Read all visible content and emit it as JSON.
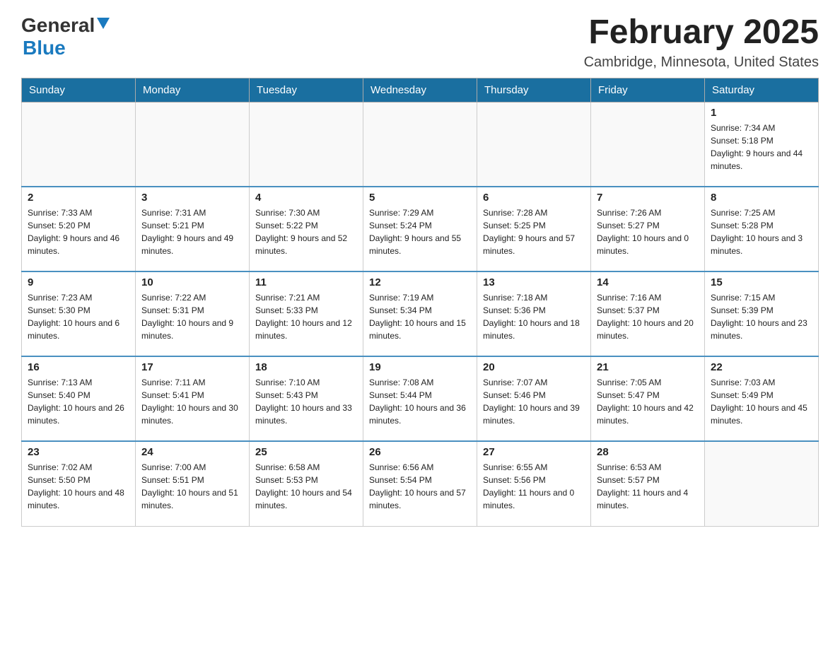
{
  "header": {
    "logo_general": "General",
    "logo_blue": "Blue",
    "month_title": "February 2025",
    "location": "Cambridge, Minnesota, United States"
  },
  "days_of_week": [
    "Sunday",
    "Monday",
    "Tuesday",
    "Wednesday",
    "Thursday",
    "Friday",
    "Saturday"
  ],
  "weeks": [
    [
      {
        "day": "",
        "info": ""
      },
      {
        "day": "",
        "info": ""
      },
      {
        "day": "",
        "info": ""
      },
      {
        "day": "",
        "info": ""
      },
      {
        "day": "",
        "info": ""
      },
      {
        "day": "",
        "info": ""
      },
      {
        "day": "1",
        "info": "Sunrise: 7:34 AM\nSunset: 5:18 PM\nDaylight: 9 hours and 44 minutes."
      }
    ],
    [
      {
        "day": "2",
        "info": "Sunrise: 7:33 AM\nSunset: 5:20 PM\nDaylight: 9 hours and 46 minutes."
      },
      {
        "day": "3",
        "info": "Sunrise: 7:31 AM\nSunset: 5:21 PM\nDaylight: 9 hours and 49 minutes."
      },
      {
        "day": "4",
        "info": "Sunrise: 7:30 AM\nSunset: 5:22 PM\nDaylight: 9 hours and 52 minutes."
      },
      {
        "day": "5",
        "info": "Sunrise: 7:29 AM\nSunset: 5:24 PM\nDaylight: 9 hours and 55 minutes."
      },
      {
        "day": "6",
        "info": "Sunrise: 7:28 AM\nSunset: 5:25 PM\nDaylight: 9 hours and 57 minutes."
      },
      {
        "day": "7",
        "info": "Sunrise: 7:26 AM\nSunset: 5:27 PM\nDaylight: 10 hours and 0 minutes."
      },
      {
        "day": "8",
        "info": "Sunrise: 7:25 AM\nSunset: 5:28 PM\nDaylight: 10 hours and 3 minutes."
      }
    ],
    [
      {
        "day": "9",
        "info": "Sunrise: 7:23 AM\nSunset: 5:30 PM\nDaylight: 10 hours and 6 minutes."
      },
      {
        "day": "10",
        "info": "Sunrise: 7:22 AM\nSunset: 5:31 PM\nDaylight: 10 hours and 9 minutes."
      },
      {
        "day": "11",
        "info": "Sunrise: 7:21 AM\nSunset: 5:33 PM\nDaylight: 10 hours and 12 minutes."
      },
      {
        "day": "12",
        "info": "Sunrise: 7:19 AM\nSunset: 5:34 PM\nDaylight: 10 hours and 15 minutes."
      },
      {
        "day": "13",
        "info": "Sunrise: 7:18 AM\nSunset: 5:36 PM\nDaylight: 10 hours and 18 minutes."
      },
      {
        "day": "14",
        "info": "Sunrise: 7:16 AM\nSunset: 5:37 PM\nDaylight: 10 hours and 20 minutes."
      },
      {
        "day": "15",
        "info": "Sunrise: 7:15 AM\nSunset: 5:39 PM\nDaylight: 10 hours and 23 minutes."
      }
    ],
    [
      {
        "day": "16",
        "info": "Sunrise: 7:13 AM\nSunset: 5:40 PM\nDaylight: 10 hours and 26 minutes."
      },
      {
        "day": "17",
        "info": "Sunrise: 7:11 AM\nSunset: 5:41 PM\nDaylight: 10 hours and 30 minutes."
      },
      {
        "day": "18",
        "info": "Sunrise: 7:10 AM\nSunset: 5:43 PM\nDaylight: 10 hours and 33 minutes."
      },
      {
        "day": "19",
        "info": "Sunrise: 7:08 AM\nSunset: 5:44 PM\nDaylight: 10 hours and 36 minutes."
      },
      {
        "day": "20",
        "info": "Sunrise: 7:07 AM\nSunset: 5:46 PM\nDaylight: 10 hours and 39 minutes."
      },
      {
        "day": "21",
        "info": "Sunrise: 7:05 AM\nSunset: 5:47 PM\nDaylight: 10 hours and 42 minutes."
      },
      {
        "day": "22",
        "info": "Sunrise: 7:03 AM\nSunset: 5:49 PM\nDaylight: 10 hours and 45 minutes."
      }
    ],
    [
      {
        "day": "23",
        "info": "Sunrise: 7:02 AM\nSunset: 5:50 PM\nDaylight: 10 hours and 48 minutes."
      },
      {
        "day": "24",
        "info": "Sunrise: 7:00 AM\nSunset: 5:51 PM\nDaylight: 10 hours and 51 minutes."
      },
      {
        "day": "25",
        "info": "Sunrise: 6:58 AM\nSunset: 5:53 PM\nDaylight: 10 hours and 54 minutes."
      },
      {
        "day": "26",
        "info": "Sunrise: 6:56 AM\nSunset: 5:54 PM\nDaylight: 10 hours and 57 minutes."
      },
      {
        "day": "27",
        "info": "Sunrise: 6:55 AM\nSunset: 5:56 PM\nDaylight: 11 hours and 0 minutes."
      },
      {
        "day": "28",
        "info": "Sunrise: 6:53 AM\nSunset: 5:57 PM\nDaylight: 11 hours and 4 minutes."
      },
      {
        "day": "",
        "info": ""
      }
    ]
  ]
}
